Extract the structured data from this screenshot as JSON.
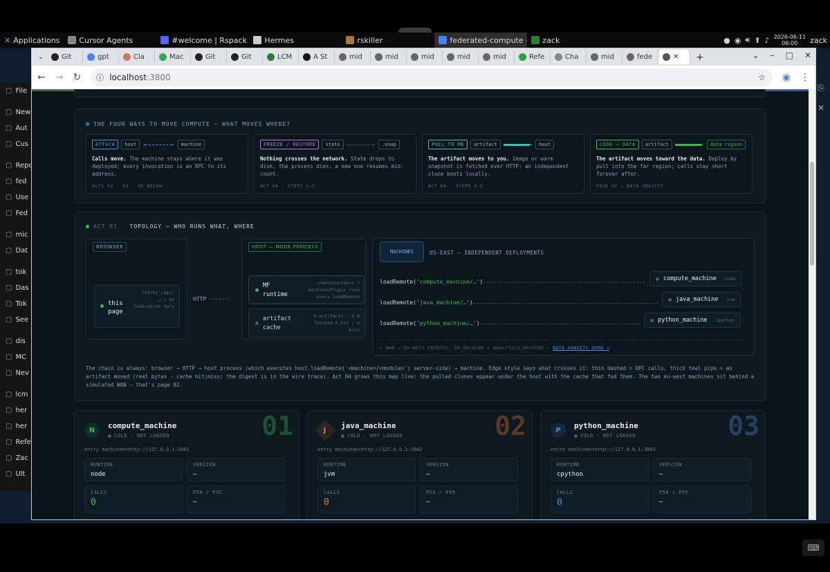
{
  "os_panel": {
    "apps_label": "Applications",
    "taskbar": [
      {
        "label": "Cursor Agents",
        "color": "#888888"
      },
      {
        "label": "#welcome | Rspack - ...",
        "color": "#5865f2"
      },
      {
        "label": "Hermes",
        "color": "#cccccc"
      },
      {
        "label": "rskiller",
        "color": "#aa7733"
      },
      {
        "label": "federated-compute — ...",
        "color": "#4285f4"
      },
      {
        "label": "zack",
        "color": "#2e7d32"
      }
    ],
    "clock_date": "2026-06-11",
    "clock_time": "06:00",
    "user": "zack"
  },
  "left_app": {
    "items": [
      "File",
      "",
      "New",
      "Aut",
      "Cus",
      "",
      "Reposi",
      "fed",
      "Use",
      "Fed",
      "",
      "mic",
      "Dat",
      "",
      "tok",
      "Das",
      "Tok",
      "See",
      "",
      "dis",
      "MC",
      "Nev",
      "",
      "lcm",
      "her",
      "her",
      "Refe",
      "Zac",
      "Ult"
    ]
  },
  "browser": {
    "tabs": [
      {
        "label": "Git",
        "fav": "#222"
      },
      {
        "label": "gpt",
        "fav": "#4285f4"
      },
      {
        "label": "Cla",
        "fav": "#cc785c"
      },
      {
        "label": "Mac",
        "fav": "#34a853"
      },
      {
        "label": "Git",
        "fav": "#222"
      },
      {
        "label": "Git",
        "fav": "#222"
      },
      {
        "label": "LCM",
        "fav": "#2e7d32"
      },
      {
        "label": "A St",
        "fav": "#111"
      },
      {
        "label": "mid",
        "fav": "#666"
      },
      {
        "label": "mid",
        "fav": "#666"
      },
      {
        "label": "mid",
        "fav": "#666"
      },
      {
        "label": "mid",
        "fav": "#666"
      },
      {
        "label": "mid",
        "fav": "#666"
      },
      {
        "label": "Refe",
        "fav": "#2ea043"
      },
      {
        "label": "Cha",
        "fav": "#888"
      },
      {
        "label": "mid",
        "fav": "#666"
      },
      {
        "label": "fede",
        "fav": "#666"
      }
    ],
    "url_host": "localhost",
    "url_port": ":3800"
  },
  "ways": {
    "title": "THE FOUR WAYS TO MOVE COMPUTE — WHAT MOVES WHERE?",
    "cards": [
      {
        "badge": "ATTACH",
        "badge_color": "#4d8fd8",
        "from": "host",
        "to": "machine",
        "arrow_color": "#4d8fd8",
        "arrow_style": "dashed-both",
        "desc_bold": "Calls move.",
        "desc": " The machine stays where it was deployed; every invocation is an RPC to its address.",
        "foot": "ACTS 02 · 03 · 05 BELOW"
      },
      {
        "badge": "FREEZE / RESTORE",
        "badge_color": "#b07ad8",
        "from": "state",
        "to": ".snap",
        "arrow_color": "#55606b",
        "arrow_style": "dotted",
        "desc_bold": "Nothing crosses the network.",
        "desc": " State drops to disk, the process dies, a new one resumes mid-count.",
        "foot": "ACT 04 · STEPS 1–3"
      },
      {
        "badge": "PULL TO ME",
        "badge_color": "#3cc1b0",
        "from": "artifact",
        "to": "host",
        "arrow_color": "#3cc1b0",
        "arrow_style": "solid",
        "desc_bold": "The artifact moves to you.",
        "desc": " Image or warm snapshot is fetched over HTTP; an independent clone boots locally.",
        "foot": "ACT 04 · STEPS 4–5"
      },
      {
        "badge": "CODE → DATA",
        "badge_color": "#4caf50",
        "from": "artifact",
        "to": "data region",
        "arrow_color": "#4caf50",
        "arrow_style": "solid",
        "desc_bold": "The artifact moves toward the data.",
        "desc": " Deploy by pull into the far region; calls stay short forever after.",
        "foot": "PAGE 02 — DATA GRAVITY"
      }
    ]
  },
  "topology": {
    "title_prefix": "ACT 01 ·",
    "title": "TOPOLOGY — WHO RUNS WHAT, WHERE",
    "browser_label": "BROWSER",
    "this_page": "this page",
    "fetch_note": "fetch('/api/ …') no federation here",
    "http_label": "HTTP",
    "host_label": "HOST — NODE PROCESS",
    "mf_runtime": "MF runtime",
    "mf_note": "createInstance + machinenPlugin runs every loadRemote",
    "artifact_cache": "artifact cache",
    "cache_note": "0 artifacts · 0 B fetched 0 hit / 0 miss",
    "machines_tab": "MACHINES",
    "region_label": "US-EAST — INDEPENDENT DEPLOYMENTS",
    "remotes": [
      {
        "call_prefix": "loadRemote('",
        "call_arg": "compute_machine/…",
        "call_suffix": "')",
        "name": "compute_machine",
        "runtime": "node"
      },
      {
        "call_prefix": "loadRemote('",
        "call_arg": "java_machine/…",
        "call_suffix": "')",
        "name": "java_machine",
        "runtime": "jvm"
      },
      {
        "call_prefix": "loadRemote('",
        "call_arg": "python_machine/…",
        "call_suffix": "')",
        "name": "python_machine",
        "runtime": "cpython"
      }
    ],
    "wan_note": "+ WAN → EU-WEST ENTRIES: DB_MACHINE + ANALYTICS_MACHINE —",
    "wan_link": "DATA GRAVITY DEMO →",
    "chain_text": "The chain is always: browser → HTTP → host process (which executes host.loadRemote('<machine>/<module>') server-side) → machine. Edge style says what crosses it: thin dashed = RPC calls, thick teal pipe = an artifact moved (real bytes · cache hit|miss; the digest is in the wire trace). Act 04 grows this map live: the pulled clones appear under the host with the cache that fed them. The two eu-west machines sit behind a simulated WAN — that's page 02."
  },
  "machines": [
    {
      "letter": "N",
      "name": "compute_machine",
      "status": "COLD · NOT LOADED",
      "number": "01",
      "color": "#3fb950",
      "entry": "entry machinen+http://127.0.0.1:3801",
      "runtime": "node",
      "version": "—",
      "calls": "0",
      "p50": "—"
    },
    {
      "letter": "J",
      "name": "java_machine",
      "status": "COLD · NOT LOADED",
      "number": "02",
      "color": "#e8793a",
      "entry": "entry machinen+http://127.0.0.1:3802",
      "runtime": "jvm",
      "version": "—",
      "calls": "0",
      "p50": "—"
    },
    {
      "letter": "P",
      "name": "python_machine",
      "status": "COLD · NOT LOADED",
      "number": "03",
      "color": "#4d8fd8",
      "entry": "entry machinen+http://127.0.0.1:3803",
      "runtime": "cpython",
      "version": "—",
      "calls": "0",
      "p50": "—"
    }
  ],
  "stat_labels": {
    "runtime": "RUNTIME",
    "version": "VERSION",
    "calls": "CALLS",
    "p50": "P50 / P95"
  }
}
